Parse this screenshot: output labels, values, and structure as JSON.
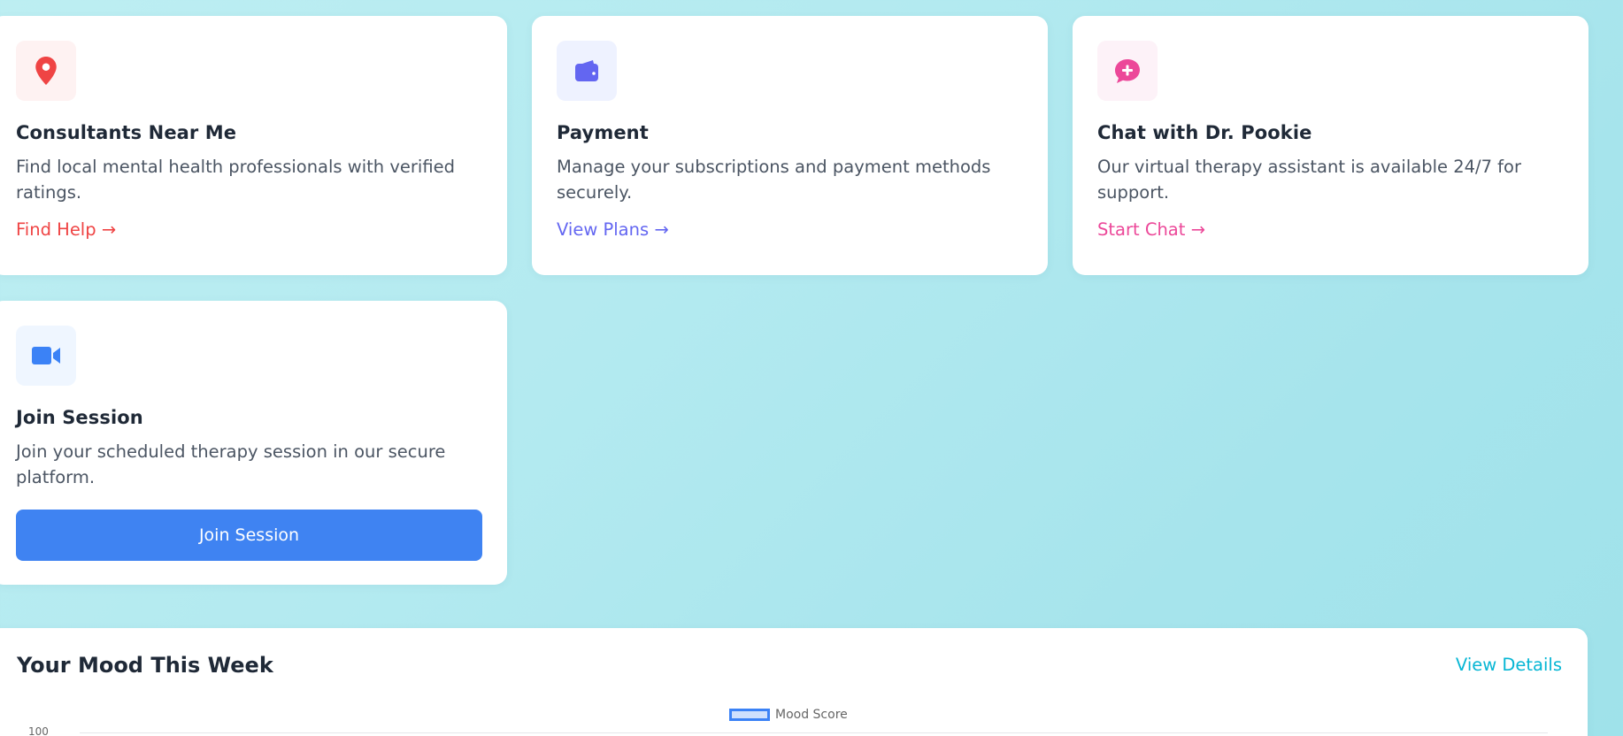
{
  "cards": {
    "consultants": {
      "icon": "location-pin-icon",
      "title": "Consultants Near Me",
      "description": "Find local mental health professionals with verified ratings.",
      "link": "Find Help →",
      "accent": "#ef4444",
      "icon_bg": "#fef2f2"
    },
    "payment": {
      "icon": "wallet-icon",
      "title": "Payment",
      "description": "Manage your subscriptions and payment methods securely.",
      "link": "View Plans →",
      "accent": "#6366f1",
      "icon_bg": "#eef2ff"
    },
    "chat": {
      "icon": "chat-plus-icon",
      "title": "Chat with Dr. Pookie",
      "description": "Our virtual therapy assistant is available 24/7 for support.",
      "link": "Start Chat →",
      "accent": "#ec4899",
      "icon_bg": "#fdf2f8"
    },
    "session": {
      "icon": "video-camera-icon",
      "title": "Join Session",
      "description": "Join your scheduled therapy session in our secure platform.",
      "button": "Join Session",
      "accent": "#3b82f6",
      "icon_bg": "#eff6ff"
    }
  },
  "mood": {
    "title": "Your Mood This Week",
    "details_link": "View Details",
    "accent": "#06b6d4"
  },
  "chart_data": {
    "type": "line",
    "series": [
      {
        "name": "Mood Score",
        "color": "#3b82f6"
      }
    ],
    "yticks_visible": [
      "100"
    ]
  }
}
